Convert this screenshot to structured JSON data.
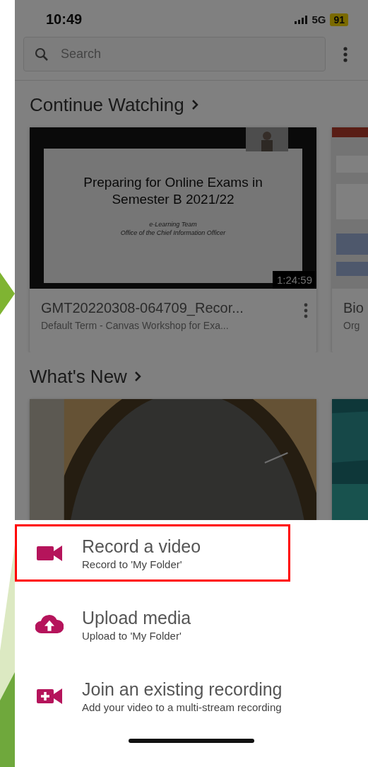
{
  "status_bar": {
    "time": "10:49",
    "network": "5G",
    "battery": "91"
  },
  "search": {
    "placeholder": "Search"
  },
  "sections": [
    {
      "title": "Continue Watching",
      "cards": [
        {
          "kind": "slide",
          "slide_title": "Preparing for Online Exams in Semester B 2021/22",
          "slide_lines": [
            "e-Learning Team",
            "Office of the Chief Information Officer"
          ],
          "duration": "1:24:59",
          "title": "GMT20220308-064709_Recor...",
          "subtitle": "Default Term - Canvas Workshop for Exa..."
        },
        {
          "kind": "picture",
          "title": "Bio",
          "subtitle": "Org"
        }
      ]
    },
    {
      "title": "What's New"
    }
  ],
  "action_sheet": {
    "items": [
      {
        "kind": "video",
        "title": "Record a video",
        "subtitle": "Record to 'My Folder'",
        "highlighted": true
      },
      {
        "kind": "upload",
        "title": "Upload media",
        "subtitle": "Upload to 'My Folder'",
        "highlighted": false
      },
      {
        "kind": "join",
        "title": "Join an existing recording",
        "subtitle": "Add your video to a multi-stream recording",
        "highlighted": false
      }
    ]
  }
}
